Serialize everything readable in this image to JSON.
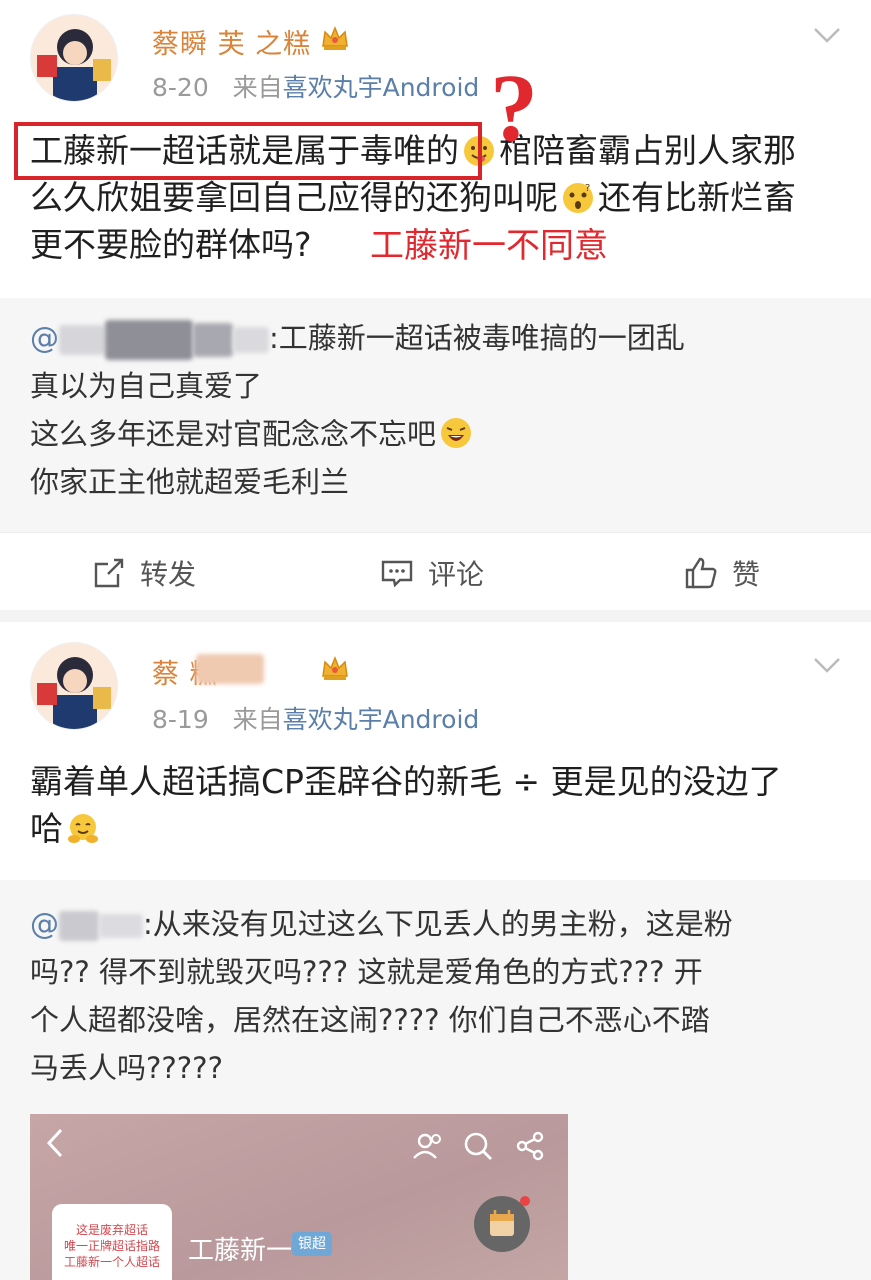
{
  "posts": [
    {
      "username": "蔡瞬 芙 之糕",
      "date": "8-20",
      "source_prefix": "来自",
      "source": "喜欢丸宇Android",
      "text_boxed": "工藤新一超话就是属于毒唯的",
      "text_rest1": "棺陪畜霸占别人家那",
      "text_line2": "么久欣姐要拿回自己应得的还狗叫呢",
      "text_line2b": "还有比新烂畜",
      "text_line3": "更不要脸的群体吗?",
      "quote": {
        "mention": "@",
        "line1": ":工藤新一超话被毒唯搞的一团乱",
        "line2": "真以为自己真爱了",
        "line3": "这么多年还是对官配念念不忘吧",
        "line4": "你家正主他就超爱毛利兰"
      },
      "actions": {
        "repost": "转发",
        "comment": "评论",
        "like": "赞"
      }
    },
    {
      "username": "蔡 糕",
      "date": "8-19",
      "source_prefix": "来自",
      "source": "喜欢丸宇Android",
      "text_line1": "霸着单人超话搞CP歪辟谷的新毛 ÷ 更是见的没边了",
      "text_line2": "哈",
      "quote": {
        "mention": "@",
        "line1": ":从来没有见过这么下见丢人的男主粉，这是粉",
        "line2": "吗?? 得不到就毁灭吗??? 这就是爱角色的方式??? 开",
        "line3": "个人超都没啥，居然在这闹???? 你们自己不恶心不踏",
        "line4": "马丢人吗?????"
      },
      "screenshot": {
        "card_line1": "这是废弃超话",
        "card_line2": "唯一正牌超话指路",
        "card_line3": "工藤新一个人超话",
        "title": "工藤新一",
        "badge": "银超"
      }
    }
  ],
  "annotation": {
    "question_mark": "?",
    "note": "工藤新一不同意"
  }
}
